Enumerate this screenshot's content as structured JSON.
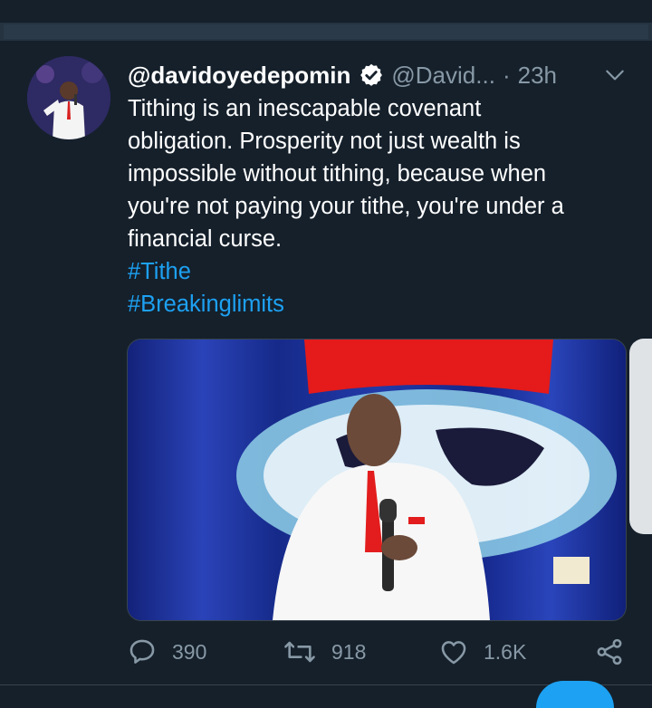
{
  "tweet": {
    "display_name": "@davidoyedepomin",
    "handle": "@David...",
    "separator": "·",
    "time": "23h",
    "text_lines": [
      "Tithing is an inescapable covenant",
      "obligation. Prosperity not just wealth is",
      "impossible without tithing, because when",
      "you're not paying your tithe, you're under a",
      "financial curse."
    ],
    "hashtags": [
      "#Tithe",
      "#Breakinglimits"
    ],
    "media_description": "Man in white suit and red tie holding a microphone in front of a blue and red globe logo"
  },
  "actions": {
    "reply_count": "390",
    "retweet_count": "918",
    "like_count": "1.6K"
  },
  "icons": {
    "verified": "verified-badge-icon",
    "caret": "chevron-down-icon",
    "reply": "reply-icon",
    "retweet": "retweet-icon",
    "like": "heart-icon",
    "share": "share-icon"
  },
  "colors": {
    "background": "#15202b",
    "accent": "#1da1f2",
    "secondary_text": "#8899a6"
  }
}
